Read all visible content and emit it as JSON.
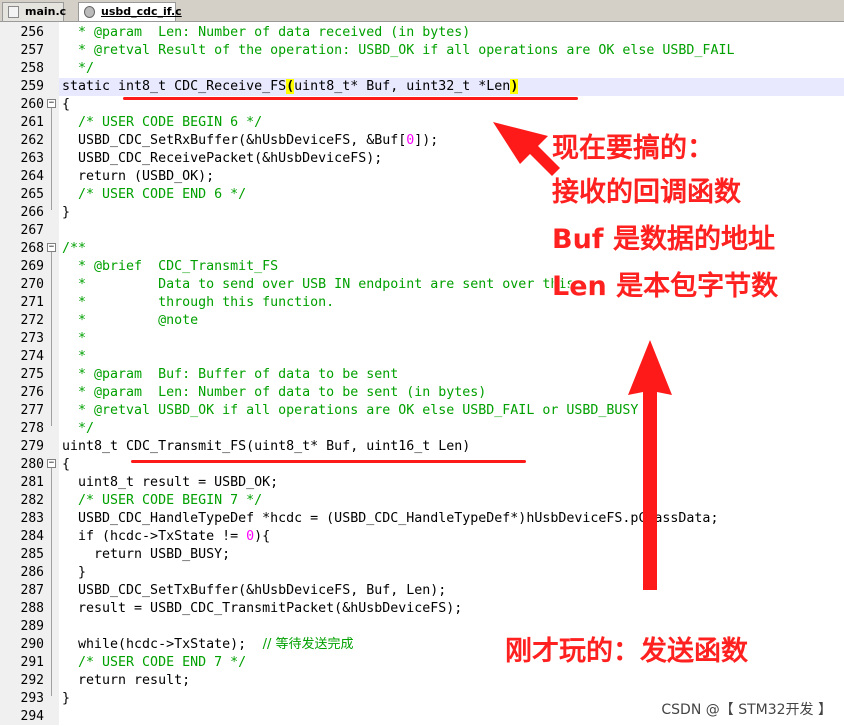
{
  "tabs": [
    {
      "label": "main.c",
      "icon": "file-icon",
      "active": false
    },
    {
      "label": "usbd_cdc_if.c",
      "icon": "gear-icon",
      "active": true
    }
  ],
  "line_numbers": [
    "256",
    "257",
    "258",
    "259",
    "260",
    "261",
    "262",
    "263",
    "264",
    "265",
    "266",
    "267",
    "268",
    "269",
    "270",
    "271",
    "272",
    "273",
    "274",
    "275",
    "276",
    "277",
    "278",
    "279",
    "280",
    "281",
    "282",
    "283",
    "284",
    "285",
    "286",
    "287",
    "288",
    "289",
    "290",
    "291",
    "292",
    "293",
    "294"
  ],
  "code": {
    "l256": "  * @param  Len: Number of data received (in bytes)",
    "l257": "  * @retval Result of the operation: USBD_OK if all operations are OK else USBD_FAIL",
    "l258": "  */",
    "l259_a": "static int8_t CDC_Receive_FS",
    "l259_b": "(",
    "l259_c": "uint8_t* Buf, uint32_t *Len",
    "l259_d": ")",
    "l260": "{",
    "l261": "  /* USER CODE BEGIN 6 */",
    "l262_a": "  USBD_CDC_SetRxBuffer(&hUsbDeviceFS, &Buf[",
    "l262_b": "0",
    "l262_c": "]);",
    "l263": "  USBD_CDC_ReceivePacket(&hUsbDeviceFS);",
    "l264": "  return (USBD_OK);",
    "l265": "  /* USER CODE END 6 */",
    "l266": "}",
    "l267": "",
    "l268": "/**",
    "l269": "  * @brief  CDC_Transmit_FS",
    "l270": "  *         Data to send over USB IN endpoint are sent over this",
    "l271": "  *         through this function.",
    "l272": "  *         @note",
    "l273": "  *",
    "l274": "  *",
    "l275": "  * @param  Buf: Buffer of data to be sent",
    "l276": "  * @param  Len: Number of data to be sent (in bytes)",
    "l277": "  * @retval USBD_OK if all operations are OK else USBD_FAIL or USBD_BUSY",
    "l278": "  */",
    "l279": "uint8_t CDC_Transmit_FS(uint8_t* Buf, uint16_t Len)",
    "l280": "{",
    "l281": "  uint8_t result = USBD_OK;",
    "l282": "  /* USER CODE BEGIN 7 */",
    "l283": "  USBD_CDC_HandleTypeDef *hcdc = (USBD_CDC_HandleTypeDef*)hUsbDeviceFS.pClassData;",
    "l284_a": "  if (hcdc->TxState != ",
    "l284_b": "0",
    "l284_c": "){",
    "l285": "    return USBD_BUSY;",
    "l286": "  }",
    "l287": "  USBD_CDC_SetTxBuffer(&hUsbDeviceFS, Buf, Len);",
    "l288": "  result = USBD_CDC_TransmitPacket(&hUsbDeviceFS);",
    "l289": "",
    "l290_a": "  while(hcdc->TxState);",
    "l290_b": "    // 等待发送完成",
    "l291": "  /* USER CODE END 7 */",
    "l292": "  return result;",
    "l293": "}",
    "l294": ""
  },
  "annotations": {
    "top": [
      "现在要搞的：",
      "接收的回调函数",
      "Buf 是数据的地址",
      "Len 是本包字节数"
    ],
    "bottom": "刚才玩的：发送函数"
  },
  "watermark": "CSDN @【 STM32开发 】",
  "colors": {
    "comment": "#00a000",
    "annotation": "#ff2020",
    "number": "#ff00ff",
    "highlight_line": "#e8e8ff"
  }
}
